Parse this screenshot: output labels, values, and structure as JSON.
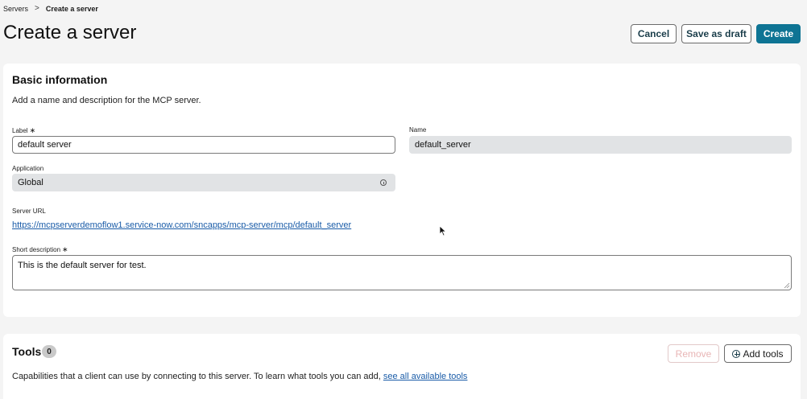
{
  "breadcrumb": {
    "parent": "Servers",
    "separator": ">",
    "current": "Create a server"
  },
  "page": {
    "title": "Create a server"
  },
  "header_actions": {
    "cancel": "Cancel",
    "save_draft": "Save as draft",
    "create": "Create"
  },
  "basic_info": {
    "title": "Basic information",
    "description": "Add a name and description for the MCP server.",
    "label_field": {
      "label": "Label",
      "required_mark": "∗",
      "value": "default server"
    },
    "name_field": {
      "label": "Name",
      "value": "default_server"
    },
    "application_field": {
      "label": "Application",
      "value": "Global"
    },
    "server_url": {
      "label": "Server URL",
      "value": "https://mcpserverdemoflow1.service-now.com/sncapps/mcp-server/mcp/default_server"
    },
    "short_description": {
      "label": "Short description",
      "required_mark": "∗",
      "value": "This is the default server for test."
    }
  },
  "tools": {
    "title": "Tools",
    "count": "0",
    "remove_label": "Remove",
    "add_label": "Add tools",
    "description": "Capabilities that a client can use by connecting to this server. To learn what tools you can add, ",
    "link_text": "see all available tools"
  },
  "icons": {
    "info": "info-circle-icon",
    "add": "plus-circle-icon",
    "breadcrumb_sep": "chevron-right-icon"
  },
  "colors": {
    "primary": "#0e7494",
    "link": "#1a5ca8",
    "background": "#f4f4f4"
  }
}
